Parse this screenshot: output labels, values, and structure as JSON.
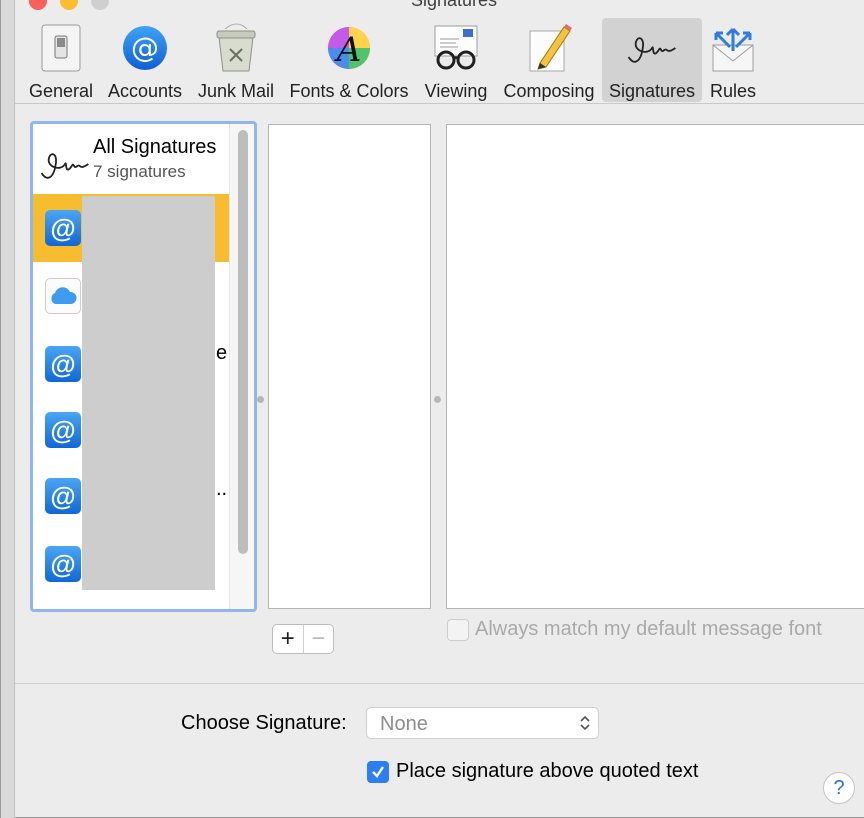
{
  "window": {
    "title": "Signatures"
  },
  "toolbar": {
    "items": [
      {
        "label": "General",
        "icon": "switch-icon"
      },
      {
        "label": "Accounts",
        "icon": "at-sign-icon"
      },
      {
        "label": "Junk Mail",
        "icon": "trash-can-icon"
      },
      {
        "label": "Fonts & Colors",
        "icon": "color-font-icon"
      },
      {
        "label": "Viewing",
        "icon": "glasses-envelope-icon"
      },
      {
        "label": "Composing",
        "icon": "pencil-paper-icon"
      },
      {
        "label": "Signatures",
        "icon": "signature-icon",
        "selected": true
      },
      {
        "label": "Rules",
        "icon": "envelope-arrows-icon"
      }
    ]
  },
  "accounts": {
    "all": {
      "title": "All Signatures",
      "count_label": "7 signatures"
    },
    "rows": [
      {
        "icon": "at",
        "trail": "",
        "selected": true
      },
      {
        "icon": "cloud",
        "trail": ""
      },
      {
        "icon": "at",
        "trail": "e"
      },
      {
        "icon": "at",
        "trail": ""
      },
      {
        "icon": "at",
        "trail": ".."
      },
      {
        "icon": "at",
        "trail": ""
      }
    ]
  },
  "signature_list": {
    "add_label": "+",
    "remove_label": "−"
  },
  "editor": {
    "match_font_label": "Always match my default message font",
    "match_font_checked": false
  },
  "bottom": {
    "choose_label": "Choose Signature:",
    "choose_value": "None",
    "place_above_label": "Place signature above quoted text",
    "place_above_checked": true,
    "help_label": "?"
  },
  "colors": {
    "accent": "#2d7ef2",
    "selected_row": "#f8bd2f",
    "focus_ring": "#8fb7ee"
  }
}
